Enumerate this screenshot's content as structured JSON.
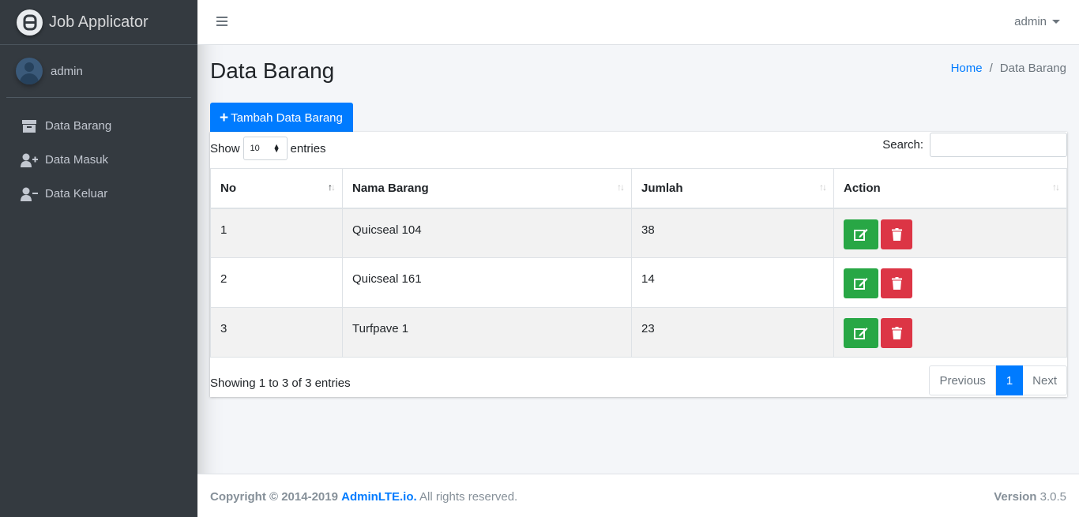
{
  "brand": {
    "title": "Job Applicator",
    "logo": "app-logo-icon"
  },
  "user_panel": {
    "name": "admin"
  },
  "sidebar": {
    "items": [
      {
        "label": "Data Barang",
        "icon": "archive-icon"
      },
      {
        "label": "Data Masuk",
        "icon": "user-plus-icon"
      },
      {
        "label": "Data Keluar",
        "icon": "user-minus-icon"
      }
    ]
  },
  "navbar": {
    "user": "admin"
  },
  "page": {
    "title": "Data Barang",
    "breadcrumb": {
      "home": "Home",
      "separator": "/",
      "current": "Data Barang"
    },
    "add_button": "Tambah Data Barang"
  },
  "table": {
    "show_label": "Show",
    "entries_label": "entries",
    "page_length": "10",
    "search_label": "Search:",
    "search_value": "",
    "columns": [
      "No",
      "Nama Barang",
      "Jumlah",
      "Action"
    ],
    "rows": [
      {
        "no": "1",
        "nama": "Quicseal 104",
        "jumlah": "38"
      },
      {
        "no": "2",
        "nama": "Quicseal 161",
        "jumlah": "14"
      },
      {
        "no": "3",
        "nama": "Turfpave 1",
        "jumlah": "23"
      }
    ],
    "info": "Showing 1 to 3 of 3 entries",
    "pagination": {
      "previous": "Previous",
      "current": "1",
      "next": "Next"
    }
  },
  "footer": {
    "copyright": "Copyright © 2014-2019",
    "link": "AdminLTE.io.",
    "rights": "All rights reserved.",
    "version_label": "Version",
    "version": "3.0.5"
  },
  "colors": {
    "primary": "#007bff",
    "success": "#28a745",
    "danger": "#dc3545",
    "sidebar": "#343a40"
  }
}
